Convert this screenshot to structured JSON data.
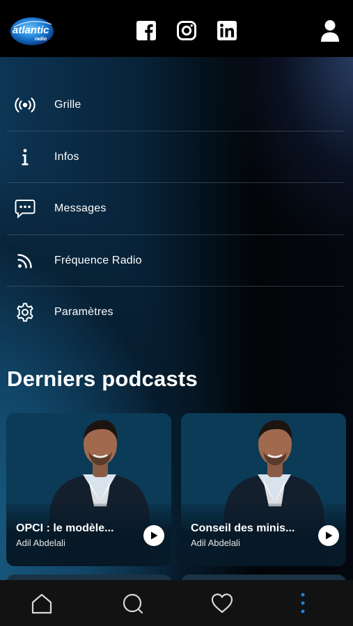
{
  "header": {
    "logo_text": "atlantic",
    "logo_subtext": "radio",
    "social": [
      {
        "name": "facebook-icon"
      },
      {
        "name": "instagram-icon"
      },
      {
        "name": "linkedin-icon"
      }
    ]
  },
  "menu": {
    "items": [
      {
        "label": "Grille",
        "icon": "broadcast-icon"
      },
      {
        "label": "Infos",
        "icon": "info-icon"
      },
      {
        "label": "Messages",
        "icon": "message-icon"
      },
      {
        "label": "Fréquence Radio",
        "icon": "rss-icon"
      },
      {
        "label": "Paramètres",
        "icon": "gear-icon"
      }
    ]
  },
  "podcasts": {
    "title": "Derniers podcasts",
    "items": [
      {
        "title": "OPCI : le modèle...",
        "author": "Adil Abdelali"
      },
      {
        "title": "Conseil des minis...",
        "author": "Adil Abdelali"
      }
    ]
  },
  "bottom_nav": {
    "items": [
      "home-icon",
      "search-icon",
      "heart-icon",
      "more-vertical-icon"
    ],
    "accent": "#1e88e5"
  },
  "colors": {
    "accent": "#1e88e5",
    "header_bg": "#000000",
    "nav_bg": "#121212"
  }
}
